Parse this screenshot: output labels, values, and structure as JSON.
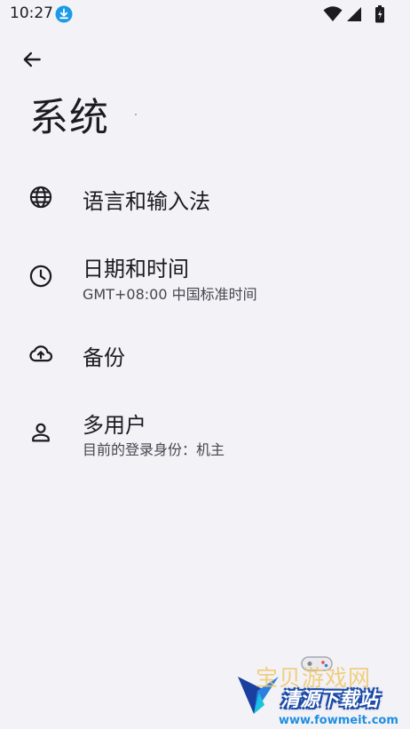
{
  "status_bar": {
    "time": "10:27"
  },
  "header": {
    "title": "系统"
  },
  "menu": {
    "items": [
      {
        "icon": "globe-icon",
        "title": "语言和输入法",
        "subtitle": ""
      },
      {
        "icon": "clock-icon",
        "title": "日期和时间",
        "subtitle": "GMT+08:00 中国标准时间"
      },
      {
        "icon": "cloud-upload-icon",
        "title": "备份",
        "subtitle": ""
      },
      {
        "icon": "person-icon",
        "title": "多用户",
        "subtitle": "目前的登录身份：机主"
      }
    ]
  },
  "watermark": {
    "faded_text": "宝贝游戏网",
    "main_text": "清源下载站",
    "url": "www.fowmeit.com"
  },
  "colors": {
    "background": "#f3f2f7",
    "text_primary": "#1c1b1f",
    "text_secondary": "#46464f",
    "download_badge": "#1a9be8"
  }
}
